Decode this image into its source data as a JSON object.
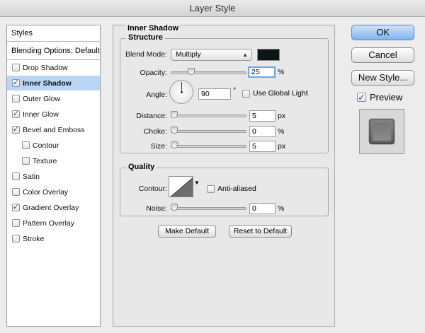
{
  "window": {
    "title": "Layer Style"
  },
  "styles_panel": {
    "header": "Styles",
    "blending_options": "Blending Options: Default",
    "items": [
      {
        "label": "Drop Shadow",
        "checked": false,
        "selected": false,
        "sub": false
      },
      {
        "label": "Inner Shadow",
        "checked": true,
        "selected": true,
        "sub": false
      },
      {
        "label": "Outer Glow",
        "checked": false,
        "selected": false,
        "sub": false
      },
      {
        "label": "Inner Glow",
        "checked": true,
        "selected": false,
        "sub": false
      },
      {
        "label": "Bevel and Emboss",
        "checked": true,
        "selected": false,
        "sub": false
      },
      {
        "label": "Contour",
        "checked": false,
        "selected": false,
        "sub": true
      },
      {
        "label": "Texture",
        "checked": false,
        "selected": false,
        "sub": true
      },
      {
        "label": "Satin",
        "checked": false,
        "selected": false,
        "sub": false
      },
      {
        "label": "Color Overlay",
        "checked": false,
        "selected": false,
        "sub": false
      },
      {
        "label": "Gradient Overlay",
        "checked": true,
        "selected": false,
        "sub": false
      },
      {
        "label": "Pattern Overlay",
        "checked": false,
        "selected": false,
        "sub": false
      },
      {
        "label": "Stroke",
        "checked": false,
        "selected": false,
        "sub": false
      }
    ]
  },
  "options": {
    "section_title": "Inner Shadow",
    "structure": {
      "title": "Structure",
      "blend_mode_label": "Blend Mode:",
      "blend_mode_value": "Multiply",
      "shadow_color": "#0d1616",
      "opacity_label": "Opacity:",
      "opacity_value": "25",
      "opacity_unit": "%",
      "angle_label": "Angle:",
      "angle_value": "90",
      "angle_unit": "°",
      "use_global_light_label": "Use Global Light",
      "use_global_light_checked": false,
      "distance_label": "Distance:",
      "distance_value": "5",
      "distance_unit": "px",
      "choke_label": "Choke:",
      "choke_value": "0",
      "choke_unit": "%",
      "size_label": "Size:",
      "size_value": "5",
      "size_unit": "px"
    },
    "quality": {
      "title": "Quality",
      "contour_label": "Contour:",
      "anti_aliased_label": "Anti-aliased",
      "anti_aliased_checked": false,
      "noise_label": "Noise:",
      "noise_value": "0",
      "noise_unit": "%"
    },
    "make_default_label": "Make Default",
    "reset_default_label": "Reset to Default"
  },
  "actions": {
    "ok_label": "OK",
    "cancel_label": "Cancel",
    "new_style_label": "New Style...",
    "preview_label": "Preview",
    "preview_checked": true
  },
  "slider_levels": {
    "opacity": 0.25,
    "distance": 0.0,
    "choke": 0.0,
    "size": 0.0,
    "noise": 0.0
  }
}
